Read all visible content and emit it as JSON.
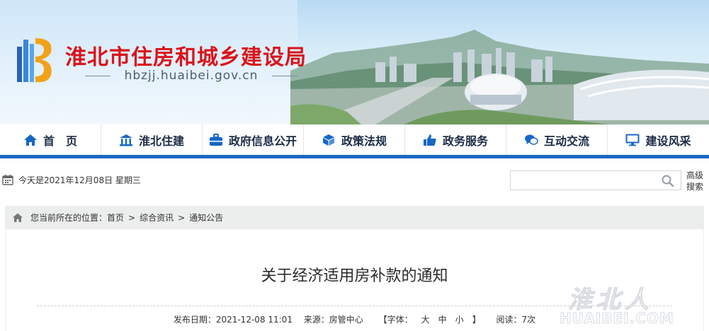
{
  "header": {
    "site_title": "淮北市住房和城乡建设局",
    "domain": "hbzjj.huaibei.gov.cn",
    "title_color": "#d9141c"
  },
  "nav": {
    "accent_color": "#1668c5",
    "items": [
      {
        "label": "首　页",
        "icon": "home-icon"
      },
      {
        "label": "淮北住建",
        "icon": "building-icon"
      },
      {
        "label": "政府信息公开",
        "icon": "briefcase-icon"
      },
      {
        "label": "政策法规",
        "icon": "cube-icon"
      },
      {
        "label": "政务服务",
        "icon": "thumbs-up-icon"
      },
      {
        "label": "互动交流",
        "icon": "chat-icon"
      },
      {
        "label": "建设风采",
        "icon": "monitor-icon"
      }
    ]
  },
  "toolbar": {
    "date_text": "今天是2021年12月08日 星期三",
    "search_placeholder": "",
    "advanced_search_label": "高级搜索"
  },
  "breadcrumb": {
    "prefix": "您当前所在的位置：",
    "items": [
      "首页",
      "综合资讯",
      "通知公告"
    ],
    "separator": ">"
  },
  "article": {
    "title": "关于经济适用房补款的通知",
    "publish_date": "发布日期：2021-12-08 11:01",
    "source": "来源：房管中心",
    "font_label_open": "【字体：",
    "font_sizes": [
      "大",
      "中",
      "小"
    ],
    "font_label_close": "】",
    "reads": "阅读：7次"
  },
  "watermark": {
    "cn": "淮北人",
    "en": "HUAIBEI.COM"
  }
}
